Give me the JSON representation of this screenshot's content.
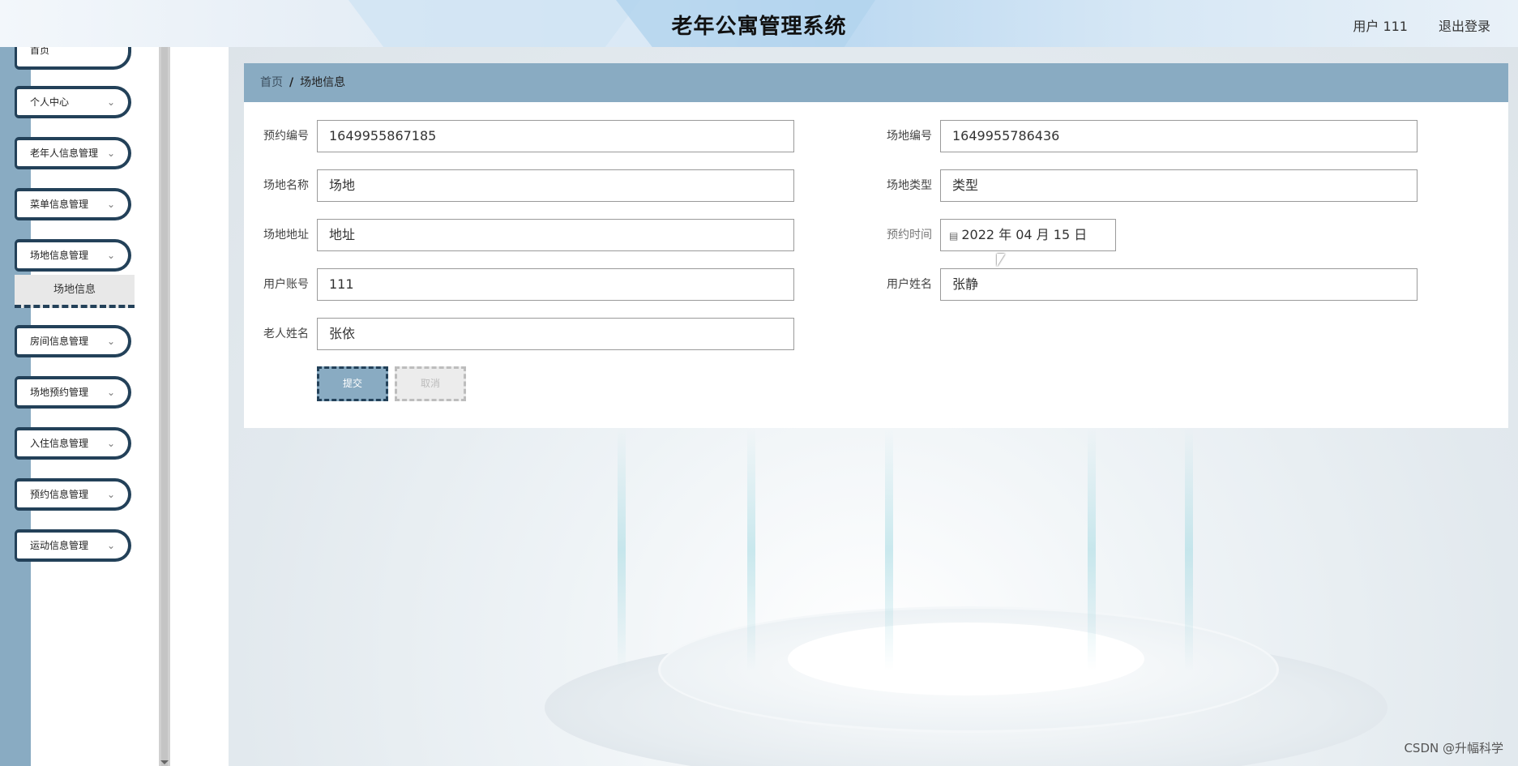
{
  "header": {
    "title": "老年公寓管理系统",
    "user_info": "用户 111",
    "logout_label": "退出登录"
  },
  "sidebar": {
    "items": [
      {
        "label": "首页"
      },
      {
        "label": "个人中心"
      },
      {
        "label": "老年人信息管理"
      },
      {
        "label": "菜单信息管理"
      },
      {
        "label": "场地信息管理"
      },
      {
        "label": "房间信息管理"
      },
      {
        "label": "场地预约管理"
      },
      {
        "label": "入住信息管理"
      },
      {
        "label": "预约信息管理"
      },
      {
        "label": "运动信息管理"
      }
    ],
    "submenu": {
      "label": "场地信息"
    },
    "chevron": "⌄"
  },
  "breadcrumb": {
    "home": "首页",
    "separator": "/",
    "current": "场地信息"
  },
  "form": {
    "reservation_no": {
      "label": "预约编号",
      "value": "1649955867185"
    },
    "venue_no": {
      "label": "场地编号",
      "value": "1649955786436"
    },
    "venue_name": {
      "label": "场地名称",
      "value": "场地"
    },
    "venue_type": {
      "label": "场地类型",
      "value": "类型"
    },
    "venue_address": {
      "label": "场地地址",
      "value": "地址"
    },
    "reservation_time": {
      "label": "预约时间",
      "value": "2022 年 04 月 15 日"
    },
    "user_account": {
      "label": "用户账号",
      "value": "111"
    },
    "user_name": {
      "label": "用户姓名",
      "value": "张静"
    },
    "elder_name": {
      "label": "老人姓名",
      "value": "张依"
    },
    "submit_label": "提交",
    "cancel_label": "取消"
  },
  "watermark": "CSDN @升幅科学",
  "colors": {
    "accent": "#89abc2",
    "dark": "#234159"
  }
}
